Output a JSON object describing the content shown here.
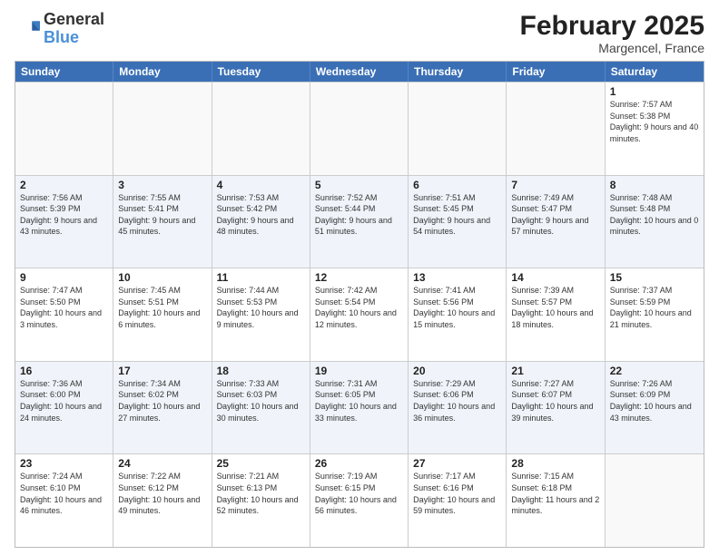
{
  "logo": {
    "general": "General",
    "blue": "Blue"
  },
  "header": {
    "title": "February 2025",
    "subtitle": "Margencel, France"
  },
  "weekdays": [
    "Sunday",
    "Monday",
    "Tuesday",
    "Wednesday",
    "Thursday",
    "Friday",
    "Saturday"
  ],
  "rows": [
    {
      "alt": false,
      "cells": [
        {
          "day": "",
          "info": ""
        },
        {
          "day": "",
          "info": ""
        },
        {
          "day": "",
          "info": ""
        },
        {
          "day": "",
          "info": ""
        },
        {
          "day": "",
          "info": ""
        },
        {
          "day": "",
          "info": ""
        },
        {
          "day": "1",
          "info": "Sunrise: 7:57 AM\nSunset: 5:38 PM\nDaylight: 9 hours and 40 minutes."
        }
      ]
    },
    {
      "alt": true,
      "cells": [
        {
          "day": "2",
          "info": "Sunrise: 7:56 AM\nSunset: 5:39 PM\nDaylight: 9 hours and 43 minutes."
        },
        {
          "day": "3",
          "info": "Sunrise: 7:55 AM\nSunset: 5:41 PM\nDaylight: 9 hours and 45 minutes."
        },
        {
          "day": "4",
          "info": "Sunrise: 7:53 AM\nSunset: 5:42 PM\nDaylight: 9 hours and 48 minutes."
        },
        {
          "day": "5",
          "info": "Sunrise: 7:52 AM\nSunset: 5:44 PM\nDaylight: 9 hours and 51 minutes."
        },
        {
          "day": "6",
          "info": "Sunrise: 7:51 AM\nSunset: 5:45 PM\nDaylight: 9 hours and 54 minutes."
        },
        {
          "day": "7",
          "info": "Sunrise: 7:49 AM\nSunset: 5:47 PM\nDaylight: 9 hours and 57 minutes."
        },
        {
          "day": "8",
          "info": "Sunrise: 7:48 AM\nSunset: 5:48 PM\nDaylight: 10 hours and 0 minutes."
        }
      ]
    },
    {
      "alt": false,
      "cells": [
        {
          "day": "9",
          "info": "Sunrise: 7:47 AM\nSunset: 5:50 PM\nDaylight: 10 hours and 3 minutes."
        },
        {
          "day": "10",
          "info": "Sunrise: 7:45 AM\nSunset: 5:51 PM\nDaylight: 10 hours and 6 minutes."
        },
        {
          "day": "11",
          "info": "Sunrise: 7:44 AM\nSunset: 5:53 PM\nDaylight: 10 hours and 9 minutes."
        },
        {
          "day": "12",
          "info": "Sunrise: 7:42 AM\nSunset: 5:54 PM\nDaylight: 10 hours and 12 minutes."
        },
        {
          "day": "13",
          "info": "Sunrise: 7:41 AM\nSunset: 5:56 PM\nDaylight: 10 hours and 15 minutes."
        },
        {
          "day": "14",
          "info": "Sunrise: 7:39 AM\nSunset: 5:57 PM\nDaylight: 10 hours and 18 minutes."
        },
        {
          "day": "15",
          "info": "Sunrise: 7:37 AM\nSunset: 5:59 PM\nDaylight: 10 hours and 21 minutes."
        }
      ]
    },
    {
      "alt": true,
      "cells": [
        {
          "day": "16",
          "info": "Sunrise: 7:36 AM\nSunset: 6:00 PM\nDaylight: 10 hours and 24 minutes."
        },
        {
          "day": "17",
          "info": "Sunrise: 7:34 AM\nSunset: 6:02 PM\nDaylight: 10 hours and 27 minutes."
        },
        {
          "day": "18",
          "info": "Sunrise: 7:33 AM\nSunset: 6:03 PM\nDaylight: 10 hours and 30 minutes."
        },
        {
          "day": "19",
          "info": "Sunrise: 7:31 AM\nSunset: 6:05 PM\nDaylight: 10 hours and 33 minutes."
        },
        {
          "day": "20",
          "info": "Sunrise: 7:29 AM\nSunset: 6:06 PM\nDaylight: 10 hours and 36 minutes."
        },
        {
          "day": "21",
          "info": "Sunrise: 7:27 AM\nSunset: 6:07 PM\nDaylight: 10 hours and 39 minutes."
        },
        {
          "day": "22",
          "info": "Sunrise: 7:26 AM\nSunset: 6:09 PM\nDaylight: 10 hours and 43 minutes."
        }
      ]
    },
    {
      "alt": false,
      "cells": [
        {
          "day": "23",
          "info": "Sunrise: 7:24 AM\nSunset: 6:10 PM\nDaylight: 10 hours and 46 minutes."
        },
        {
          "day": "24",
          "info": "Sunrise: 7:22 AM\nSunset: 6:12 PM\nDaylight: 10 hours and 49 minutes."
        },
        {
          "day": "25",
          "info": "Sunrise: 7:21 AM\nSunset: 6:13 PM\nDaylight: 10 hours and 52 minutes."
        },
        {
          "day": "26",
          "info": "Sunrise: 7:19 AM\nSunset: 6:15 PM\nDaylight: 10 hours and 56 minutes."
        },
        {
          "day": "27",
          "info": "Sunrise: 7:17 AM\nSunset: 6:16 PM\nDaylight: 10 hours and 59 minutes."
        },
        {
          "day": "28",
          "info": "Sunrise: 7:15 AM\nSunset: 6:18 PM\nDaylight: 11 hours and 2 minutes."
        },
        {
          "day": "",
          "info": ""
        }
      ]
    }
  ]
}
